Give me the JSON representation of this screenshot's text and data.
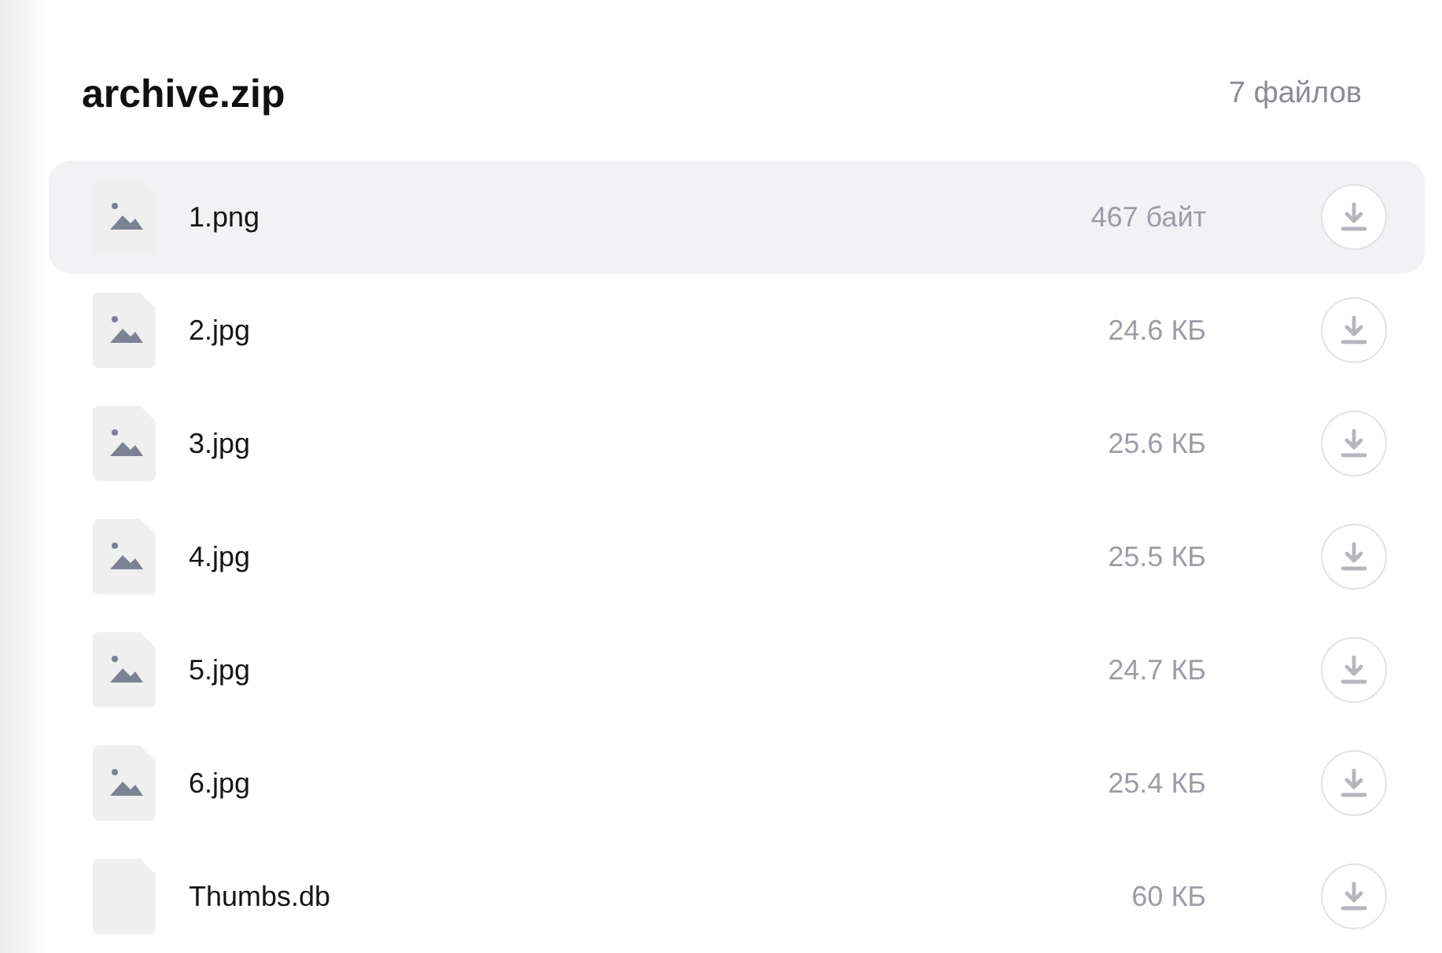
{
  "archive": {
    "title": "archive.zip",
    "file_count": "7 файлов"
  },
  "files": [
    {
      "name": "1.png",
      "size": "467 байт",
      "kind": "image",
      "selected": true
    },
    {
      "name": "2.jpg",
      "size": "24.6 КБ",
      "kind": "image",
      "selected": false
    },
    {
      "name": "3.jpg",
      "size": "25.6 КБ",
      "kind": "image",
      "selected": false
    },
    {
      "name": "4.jpg",
      "size": "25.5 КБ",
      "kind": "image",
      "selected": false
    },
    {
      "name": "5.jpg",
      "size": "24.7 КБ",
      "kind": "image",
      "selected": false
    },
    {
      "name": "6.jpg",
      "size": "25.4 КБ",
      "kind": "image",
      "selected": false
    },
    {
      "name": "Thumbs.db",
      "size": "60 КБ",
      "kind": "file",
      "selected": false
    }
  ]
}
